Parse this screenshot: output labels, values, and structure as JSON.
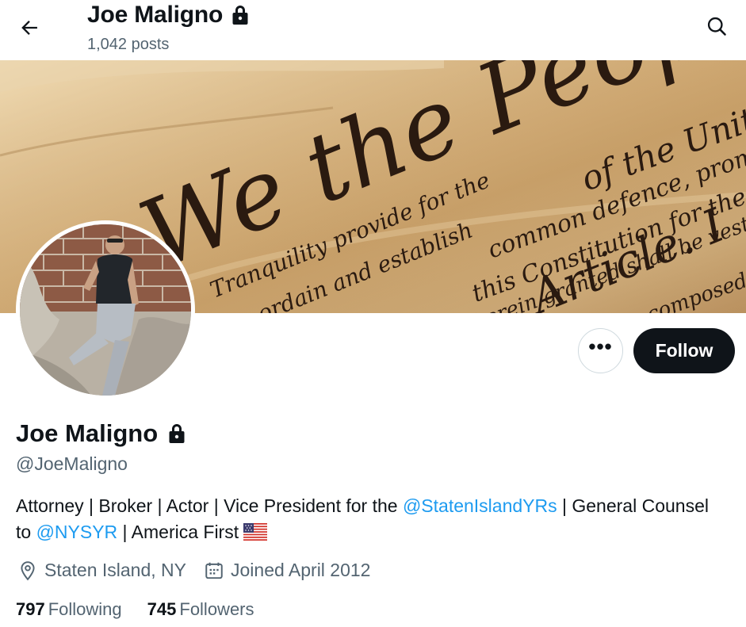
{
  "topbar": {
    "name": "Joe Maligno",
    "posts": "1,042 posts",
    "icons": [
      "back-arrow-icon",
      "lock-icon",
      "search-icon"
    ]
  },
  "profile": {
    "name": "Joe Maligno",
    "handle": "@JoeMaligno",
    "bio": {
      "part1": "Attorney | Broker | Actor | Vice President for the ",
      "mention1": "@StatenIslandYRs",
      "part2": " | General Counsel to ",
      "mention2": "@NYSYR",
      "part3": " | America First"
    },
    "location": "Staten Island, NY",
    "joined": "Joined April 2012",
    "following_count": "797",
    "following_label": "Following",
    "followers_count": "745",
    "followers_label": "Followers"
  },
  "actions": {
    "more": "•••",
    "follow": "Follow"
  },
  "banner": {
    "script_lines": [
      "We the People",
      "of the Unit",
      "common defence, promot",
      "this Constitution for the",
      "Article. I",
      "Tranquility provide for the",
      "ordain and establish",
      "herein granted shall be vested",
      "composed of"
    ]
  },
  "colors": {
    "accent": "#1d9bf0",
    "text": "#0f1419",
    "muted": "#536471",
    "follow_bg": "#0f1419"
  }
}
